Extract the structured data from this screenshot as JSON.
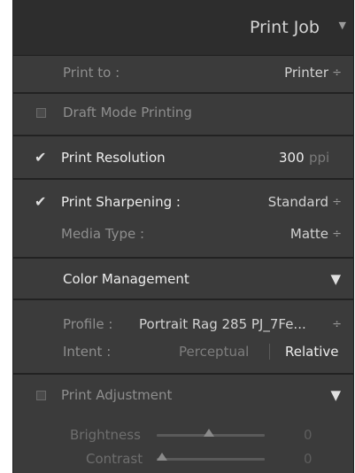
{
  "panel": {
    "title": "Print Job",
    "collapse_icon": "triangle-down-icon"
  },
  "print_to": {
    "label": "Print to :",
    "value": "Printer",
    "spinner": "÷"
  },
  "draft_mode": {
    "label": "Draft Mode Printing",
    "checked": false
  },
  "resolution": {
    "label": "Print Resolution",
    "checked": true,
    "value": "300",
    "unit": "ppi"
  },
  "sharpening": {
    "label": "Print Sharpening :",
    "checked": true,
    "value": "Standard",
    "spinner": "÷",
    "media_label": "Media Type :",
    "media_value": "Matte",
    "media_spinner": "÷"
  },
  "color_management": {
    "label": "Color Management",
    "profile_label": "Profile :",
    "profile_value": "Portrait Rag 285 PJ_7Fe...",
    "profile_spinner": "÷",
    "intent_label": "Intent :",
    "intent_perceptual": "Perceptual",
    "intent_relative": "Relative"
  },
  "print_adjustment": {
    "label": "Print Adjustment",
    "checked": false,
    "brightness_label": "Brightness",
    "brightness_value": "0",
    "contrast_label": "Contrast",
    "contrast_value": "0"
  },
  "icons": {
    "check": "✔",
    "section_toggle": "▼",
    "header_toggle": "▼"
  }
}
